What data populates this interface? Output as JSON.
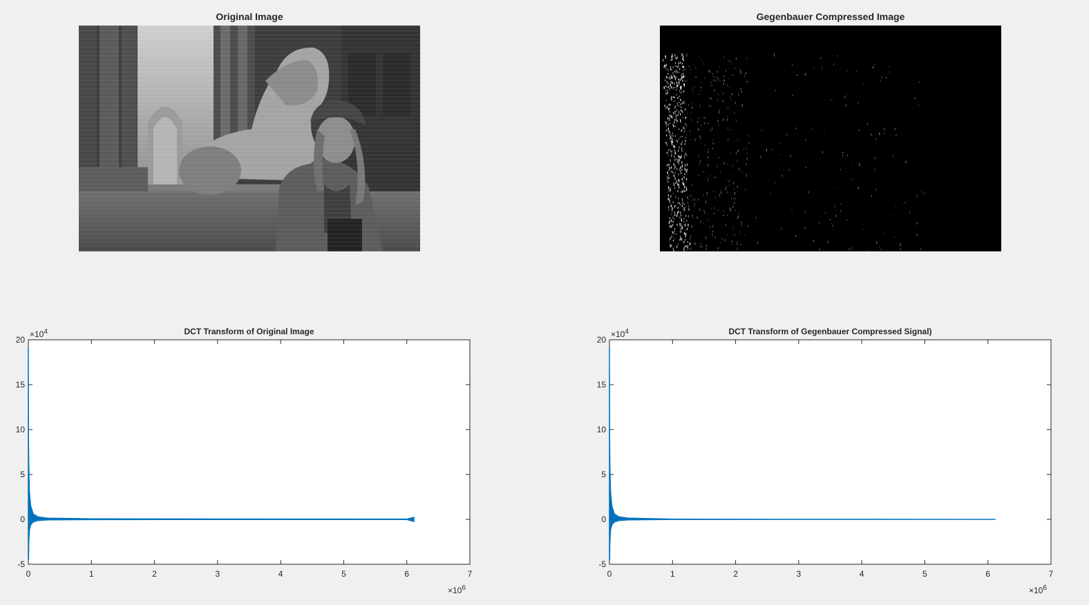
{
  "figure": {
    "panels": [
      {
        "title": "Original Image"
      },
      {
        "title": "Gegenbauer Compressed Image"
      }
    ]
  },
  "colors": {
    "series": "#0072bd",
    "axis": "#262626",
    "figure_bg": "#f0f0f0"
  },
  "chart_data": [
    {
      "type": "line",
      "title": "DCT Transform of Original Image",
      "xlabel": "",
      "ylabel": "",
      "xlim": [
        0,
        7000000
      ],
      "ylim": [
        -50000,
        200000
      ],
      "x_ticks": [
        0,
        1,
        2,
        3,
        4,
        5,
        6,
        7
      ],
      "y_ticks": [
        -5,
        0,
        5,
        10,
        15,
        20
      ],
      "x_exponent": "6",
      "y_exponent": "4",
      "grid": false,
      "series": [
        {
          "x": [
            0,
            5000,
            10000,
            20000,
            40000,
            80000,
            150000,
            300000,
            1000000,
            3000000,
            6000000,
            6115000
          ],
          "y_max": [
            190000,
            90000,
            60000,
            30000,
            15000,
            6000,
            3000,
            1500,
            800,
            600,
            500,
            2500
          ],
          "y_min": [
            -45000,
            -45000,
            -25000,
            -12000,
            -6000,
            -3000,
            -1500,
            -800,
            -500,
            -400,
            -400,
            -2500
          ]
        }
      ]
    },
    {
      "type": "line",
      "title": "DCT Transform of Gegenbauer Compressed Signal)",
      "xlabel": "",
      "ylabel": "",
      "xlim": [
        0,
        7000000
      ],
      "ylim": [
        -50000,
        200000
      ],
      "x_ticks": [
        0,
        1,
        2,
        3,
        4,
        5,
        6,
        7
      ],
      "y_ticks": [
        -5,
        0,
        5,
        10,
        15,
        20
      ],
      "x_exponent": "6",
      "y_exponent": "4",
      "grid": false,
      "series": [
        {
          "x": [
            0,
            5000,
            10000,
            20000,
            40000,
            80000,
            150000,
            300000,
            1000000,
            3000000,
            6000000,
            6115000
          ],
          "y_max": [
            190000,
            90000,
            60000,
            30000,
            15000,
            6000,
            3000,
            1500,
            500,
            300,
            200,
            200
          ],
          "y_min": [
            -45000,
            -45000,
            -25000,
            -12000,
            -6000,
            -3000,
            -1500,
            -800,
            -300,
            -200,
            -200,
            -200
          ]
        }
      ]
    }
  ]
}
